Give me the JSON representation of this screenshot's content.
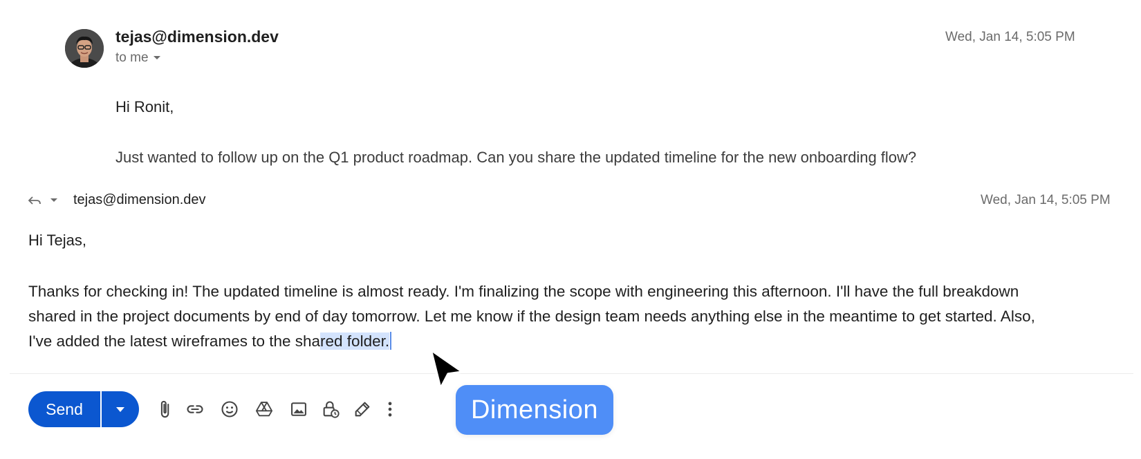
{
  "message": {
    "sender": "tejas@dimension.dev",
    "recipient_label": "to me",
    "date": "Wed, Jan 14, 5:05 PM",
    "greeting": "Hi Ronit,",
    "body": "Just wanted to follow up on the Q1 product roadmap. Can you share the updated timeline for the new onboarding flow?"
  },
  "reply": {
    "to": "tejas@dimension.dev",
    "date": "Wed, Jan 14, 5:05 PM",
    "greeting": "Hi Tejas,",
    "line1": "Thanks for checking in! The updated timeline is almost ready. I'm finalizing the scope with engineering this afternoon. I'll have the full breakdown",
    "line2": "shared in the project documents by end of day tomorrow. Let me know if the design team needs anything else in the meantime to get started. Also,",
    "line3_plain": "I've added the latest wireframes to the sha",
    "line3_selected": "red folder."
  },
  "toolbar": {
    "send_label": "Send",
    "icons": [
      "attach-icon",
      "link-icon",
      "emoji-icon",
      "drive-icon",
      "photo-icon",
      "confidential-icon",
      "signature-icon",
      "more-options-icon"
    ]
  },
  "overlay": {
    "badge_label": "Dimension"
  },
  "colors": {
    "send_button": "#0b57d0",
    "badge": "#4f8ef7",
    "selection": "#d3e3fd"
  }
}
